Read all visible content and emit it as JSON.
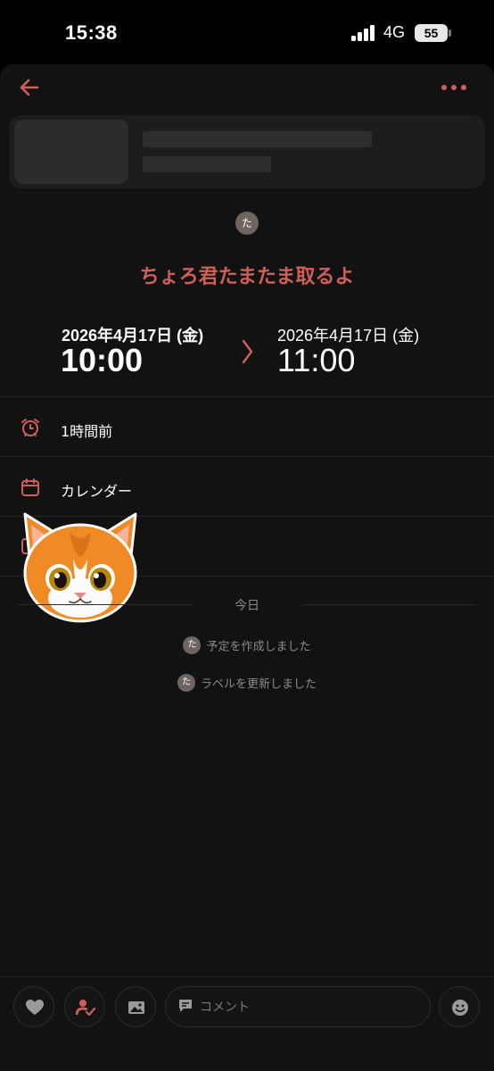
{
  "status_bar": {
    "time": "15:38",
    "network": "4G",
    "battery": "55"
  },
  "header": {
    "back_icon": "arrow-left-icon",
    "more_icon": "ellipsis-icon"
  },
  "event": {
    "creator_initial": "た",
    "title": "ちょろ君たまたま取るよ",
    "start": {
      "date": "2026年4月17日 (金)",
      "time": "10:00"
    },
    "end": {
      "date": "2026年4月17日 (金)",
      "time": "11:00"
    }
  },
  "details": {
    "reminder": {
      "icon": "alarm-clock-icon",
      "label": "1時間前"
    },
    "calendar": {
      "icon": "calendar-icon",
      "label": "カレンダー"
    }
  },
  "activity": {
    "section_label": "今日",
    "items": [
      {
        "initial": "た",
        "text": "予定を作成しました"
      },
      {
        "initial": "た",
        "text": "ラベルを更新しました"
      }
    ]
  },
  "footer": {
    "buttons": [
      "heart-icon",
      "person-check-icon",
      "image-icon",
      "emoji-icon"
    ],
    "comment_placeholder": "コメント"
  },
  "colors": {
    "accent": "#cf5f58",
    "background": "#121212",
    "status_bar": "#000000"
  }
}
